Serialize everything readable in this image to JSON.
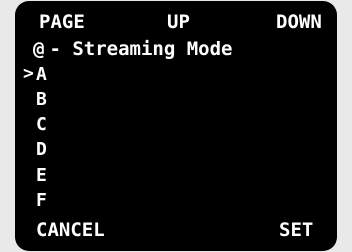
{
  "softkeys_top": {
    "page": "PAGE",
    "up": "UP",
    "down": "DOWN"
  },
  "title": {
    "icon": "@",
    "text": "- Streaming Mode"
  },
  "cursor": ">",
  "items": [
    "A",
    "B",
    "C",
    "D",
    "E",
    "F"
  ],
  "selected_index": 0,
  "softkeys_bottom": {
    "cancel": "CANCEL",
    "set": "SET"
  },
  "colors": {
    "background": "#000000",
    "text": "#ffffff",
    "outer": "#e9e9e9"
  }
}
